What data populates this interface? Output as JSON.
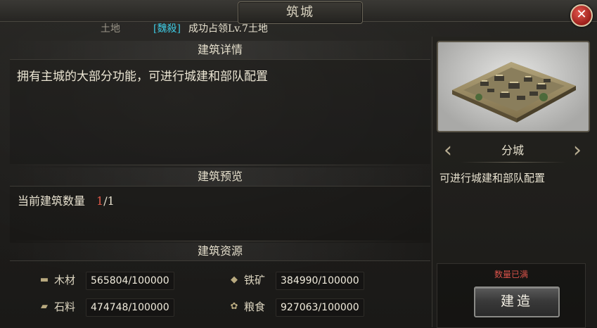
{
  "window": {
    "title": "筑城",
    "close_symbol": "✕"
  },
  "subheader": {
    "land_label": "土地",
    "alliance_tag": "[魏殺]",
    "message": "成功占领Lv.7土地"
  },
  "sections": {
    "details": {
      "heading": "建筑详情",
      "description": "拥有主城的大部分功能，可进行城建和部队配置"
    },
    "preview": {
      "heading": "建筑预览",
      "count_label": "当前建筑数量",
      "count_current": "1",
      "count_total": "/1"
    },
    "resources": {
      "heading": "建筑资源",
      "items": [
        {
          "icon": "wood-icon",
          "name": "木材",
          "value": "565804/100000"
        },
        {
          "icon": "iron-ore-icon",
          "name": "铁矿",
          "value": "384990/100000"
        },
        {
          "icon": "stone-icon",
          "name": "石料",
          "value": "474748/100000"
        },
        {
          "icon": "grain-icon",
          "name": "粮食",
          "value": "927063/100000"
        }
      ]
    }
  },
  "right_panel": {
    "building_name": "分城",
    "description": "可进行城建和部队配置",
    "status": "数量已满",
    "build_button": "建造"
  },
  "colors": {
    "alliance_tag": "#3ec8e0",
    "count_current": "#e05a4a",
    "status": "#d8524a",
    "close_button": "#c0302a"
  }
}
